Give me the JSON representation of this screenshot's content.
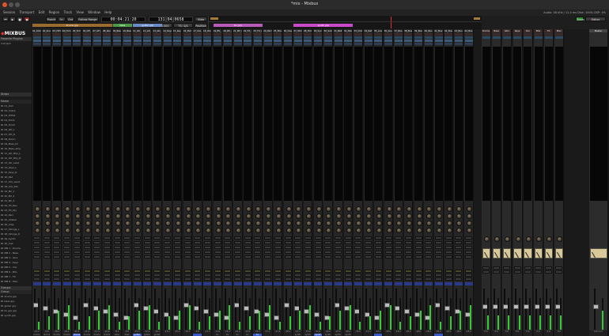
{
  "window": {
    "title": "*mix - Mixbus"
  },
  "menu": [
    "Session",
    "Transport",
    "Edit",
    "Region",
    "Track",
    "View",
    "Window",
    "Help"
  ],
  "menu_right": "Audio: 48 kHz / 11.4 ms   Disk: 100%   DSP: 4%",
  "toolbar": {
    "punch": "Punch",
    "in": "In",
    "out": "Out",
    "follow_range": "Follow Range",
    "rec": "Rec",
    "rec_mode": "Sound on Sound",
    "auto_return": "Auto Return",
    "clock_primary": "00:04:21:20",
    "clock_secondary": "131|04|0658",
    "sync": "Int",
    "tempo": "♩ = 120.000",
    "meter": "TS: 4/4",
    "position": "Position",
    "edit_mode": "Slide",
    "zoom": "Zoom",
    "right_panel": "Editor"
  },
  "left_panel": {
    "logo": "MIXBUS",
    "favorites_header": "Favorite Plugins",
    "favorites": [
      "Calf Jack"
    ],
    "strips_header": "Strips",
    "strips_col": "Name",
    "tracks": [
      "01_Kick",
      "02_Snare",
      "03_HiHat",
      "04_Tom1",
      "05_Tom2",
      "06_OH_L",
      "07_OH_R",
      "08_Room",
      "09_Bass_DI",
      "10_Bass_Amp",
      "11_Gtr_Rhy_L",
      "12_Gtr_Rhy_R",
      "13_Gtr_Lead",
      "14_Keys_L",
      "15_Keys_R",
      "16_Pad",
      "17_Vox_Lead",
      "18_Vox_Dbl",
      "19_BV_1",
      "20_BV_2",
      "21_BV_3",
      "22_FX_Rev",
      "23_FX_Dly",
      "24_Perc",
      "25_Shaker",
      "26_Clap",
      "27_Strings_L",
      "28_Strings_R",
      "29_Synth",
      "30_Sub",
      "MB 1 - Drums",
      "MB 2 - Bass",
      "MB 3 - Gtrs",
      "MB 4 - Keys",
      "MB 5 - Vox",
      "MB 6 - BVs",
      "MB 7 - FX",
      "MB 8 - Misc"
    ],
    "groups_header": "Groups",
    "groups_col": "Group",
    "groups": [
      "drums grp",
      "bass grp",
      "guitar grp",
      "bv grp grp",
      "synth grp"
    ]
  },
  "strip_header_labels": {
    "eq": "EQ",
    "comp": "Comp",
    "sends": "Sends"
  },
  "strips": [
    {
      "name": "01_Kick",
      "group": "drums",
      "out": "-14.2"
    },
    {
      "name": "02_Snare",
      "group": "drums",
      "out": "-9.8"
    },
    {
      "name": "03_HiHat",
      "group": "drums",
      "out": "-18.0"
    },
    {
      "name": "04_Tom1",
      "group": "drums",
      "out": "-22.1"
    },
    {
      "name": "05_Tom2",
      "group": "drums",
      "out": "-20.4"
    },
    {
      "name": "06_OH_L",
      "group": "drums",
      "out": "-11.0"
    },
    {
      "name": "07_OH_R",
      "group": "drums",
      "out": "-11.3"
    },
    {
      "name": "08_Room",
      "group": "drums",
      "out": "-16.6"
    },
    {
      "name": "09_Bass_DI",
      "group": "bass",
      "out": "-8.2"
    },
    {
      "name": "10_Bass_Amp",
      "group": "bass",
      "out": "-9.0"
    },
    {
      "name": "11_Gtr_Rhy_L",
      "group": "guitar",
      "out": "-12.5"
    },
    {
      "name": "12_Gtr_Rhy_R",
      "group": "guitar",
      "out": "-12.9"
    },
    {
      "name": "13_Gtr_Lead",
      "group": "guitar",
      "out": "-10.1"
    },
    {
      "name": "14_Keys_L",
      "group": "",
      "out": "-15.0"
    },
    {
      "name": "15_Keys_R",
      "group": "",
      "out": "-15.4"
    },
    {
      "name": "16_Pad",
      "group": "",
      "out": "-19.7"
    },
    {
      "name": "17_Vox_Lead",
      "group": "",
      "out": "-6.8"
    },
    {
      "name": "18_Vox_Dbl",
      "group": "",
      "out": "-13.3"
    },
    {
      "name": "19_BV_1",
      "group": "bv",
      "out": "-14.9"
    },
    {
      "name": "20_BV_2",
      "group": "bv",
      "out": "-15.2"
    },
    {
      "name": "21_BV_3",
      "group": "bv",
      "out": "-16.0"
    },
    {
      "name": "22_FX_Rev",
      "group": "bv",
      "out": "-24.0"
    },
    {
      "name": "23_FX_Dly",
      "group": "bv",
      "out": "-25.3"
    },
    {
      "name": "24_Perc",
      "group": "",
      "out": "-17.1"
    },
    {
      "name": "25_Shaker",
      "group": "",
      "out": "-21.8"
    },
    {
      "name": "26_Clap",
      "group": "",
      "out": "-18.4"
    },
    {
      "name": "27_Strings_L",
      "group": "synth",
      "out": "-13.7"
    },
    {
      "name": "28_Strings_R",
      "group": "synth",
      "out": "-13.9"
    },
    {
      "name": "29_Synth",
      "group": "synth",
      "out": "-11.6"
    },
    {
      "name": "30_Sub",
      "group": "synth",
      "out": "-20.0"
    },
    {
      "name": "31_Bell",
      "group": "synth",
      "out": "-22.5"
    },
    {
      "name": "32_Noise",
      "group": "synth",
      "out": "-26.0"
    },
    {
      "name": "33_Click",
      "group": "",
      "out": "-30.0"
    },
    {
      "name": "34_Ref",
      "group": "",
      "out": "-12.0"
    },
    {
      "name": "35_Aux",
      "group": "",
      "out": "-28.0"
    },
    {
      "name": "36_Aux2",
      "group": "",
      "out": "-29.0"
    },
    {
      "name": "37_Bus",
      "group": "",
      "out": "-18.0"
    },
    {
      "name": "38_Bus",
      "group": "",
      "out": "-18.0"
    },
    {
      "name": "39_Bus",
      "group": "",
      "out": "-18.0"
    },
    {
      "name": "40_Bus",
      "group": "",
      "out": "-18.0"
    },
    {
      "name": "41_Bus",
      "group": "",
      "out": "-18.0"
    },
    {
      "name": "42_Bus",
      "group": "",
      "out": "-18.0"
    },
    {
      "name": "43_Bus",
      "group": "",
      "out": "-18.0"
    },
    {
      "name": "44_Bus",
      "group": "",
      "out": "-18.0"
    },
    {
      "name": "45_Bus",
      "group": "",
      "out": "-18.0"
    },
    {
      "name": "46_Bus",
      "group": "",
      "out": "-18.0"
    },
    {
      "name": "47_Bus",
      "group": "",
      "out": "-18.0"
    }
  ],
  "group_tabs": [
    {
      "label": "drums grp",
      "color": "#9a6a2e"
    },
    {
      "label": "bass",
      "color": "#4a9a4a"
    },
    {
      "label": "guitar grp",
      "color": "#6a8ac8"
    },
    {
      "label": "bv grp",
      "color": "#b85ab8"
    },
    {
      "label": "synth grp",
      "color": "#c84ac8"
    }
  ],
  "buses": [
    {
      "name": "Drums",
      "level": "0.0"
    },
    {
      "name": "Bass",
      "level": "0.0"
    },
    {
      "name": "Gtrs",
      "level": "0.0"
    },
    {
      "name": "Keys",
      "level": "0.0"
    },
    {
      "name": "Vox",
      "level": "0.0"
    },
    {
      "name": "BVs",
      "level": "0.0"
    },
    {
      "name": "FX",
      "level": "0.0"
    },
    {
      "name": "Misc",
      "level": "0.0"
    }
  ],
  "master": {
    "name": "Master",
    "out": "Out 1+2"
  }
}
